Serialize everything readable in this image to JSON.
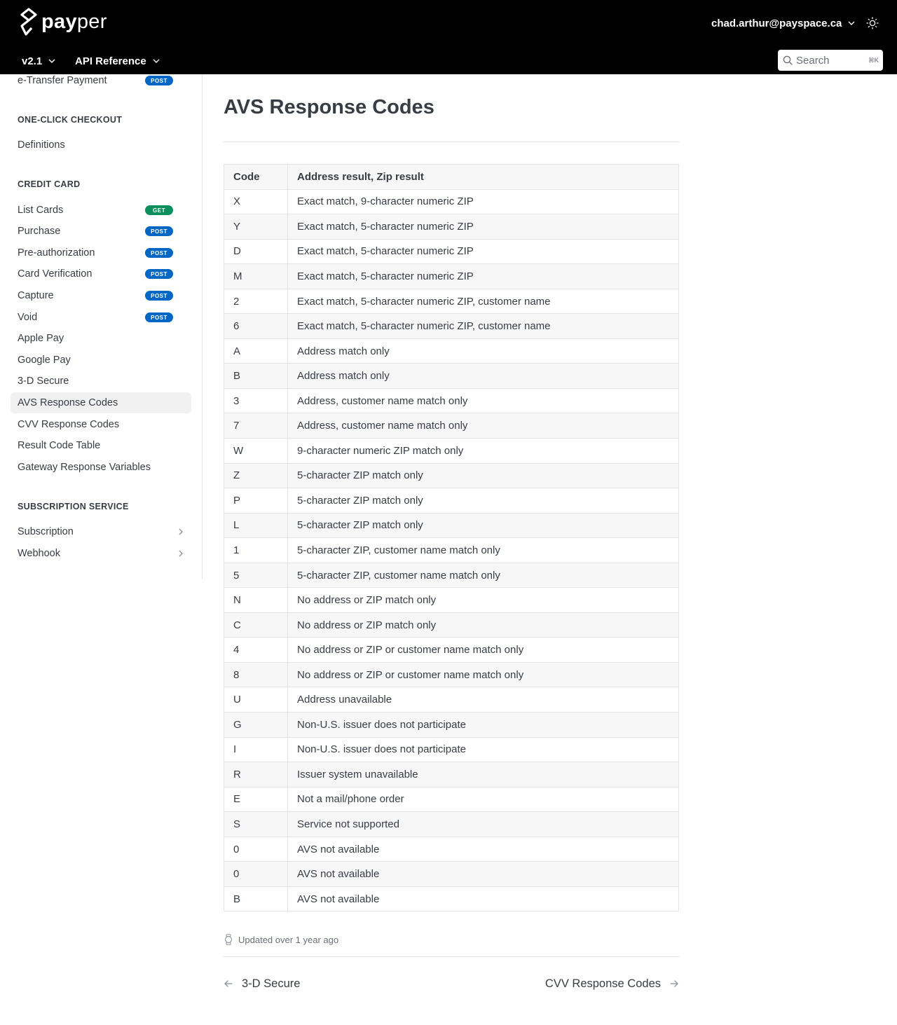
{
  "brand": {
    "name_bold": "pay",
    "name_regular": "per"
  },
  "header": {
    "user_email": "chad.arthur@payspace.ca",
    "version_label": "v2.1",
    "reference_label": "API Reference",
    "search_placeholder": "Search",
    "search_shortcut": "⌘K"
  },
  "sidebar": {
    "top_item": {
      "label": "e-Transfer Payment",
      "badge": "POST"
    },
    "sections": [
      {
        "title": "ONE-CLICK CHECKOUT",
        "items": [
          {
            "label": "Definitions"
          }
        ]
      },
      {
        "title": "CREDIT CARD",
        "items": [
          {
            "label": "List Cards",
            "badge": "GET"
          },
          {
            "label": "Purchase",
            "badge": "POST"
          },
          {
            "label": "Pre-authorization",
            "badge": "POST"
          },
          {
            "label": "Card Verification",
            "badge": "POST"
          },
          {
            "label": "Capture",
            "badge": "POST"
          },
          {
            "label": "Void",
            "badge": "POST"
          },
          {
            "label": "Apple Pay"
          },
          {
            "label": "Google Pay"
          },
          {
            "label": "3-D Secure"
          },
          {
            "label": "AVS Response Codes",
            "active": true
          },
          {
            "label": "CVV Response Codes"
          },
          {
            "label": "Result Code Table"
          },
          {
            "label": "Gateway Response Variables"
          }
        ]
      },
      {
        "title": "SUBSCRIPTION SERVICE",
        "items": [
          {
            "label": "Subscription"
          },
          {
            "label": "Webhook"
          }
        ]
      }
    ]
  },
  "page": {
    "title": "AVS Response Codes",
    "table": {
      "headers": [
        "Code",
        "Address result, Zip result"
      ],
      "rows": [
        [
          "X",
          "Exact match, 9-character numeric ZIP"
        ],
        [
          "Y",
          "Exact match, 5-character numeric ZIP"
        ],
        [
          "D",
          "Exact match, 5-character numeric ZIP"
        ],
        [
          "M",
          "Exact match, 5-character numeric ZIP"
        ],
        [
          "2",
          "Exact match, 5-character numeric ZIP, customer name"
        ],
        [
          "6",
          "Exact match, 5-character numeric ZIP, customer name"
        ],
        [
          "A",
          "Address match only"
        ],
        [
          "B",
          "Address match only"
        ],
        [
          "3",
          "Address, customer name match only"
        ],
        [
          "7",
          "Address, customer name match only"
        ],
        [
          "W",
          "9-character numeric ZIP match only"
        ],
        [
          "Z",
          "5-character ZIP match only"
        ],
        [
          "P",
          "5-character ZIP match only"
        ],
        [
          "L",
          "5-character ZIP match only"
        ],
        [
          "1",
          "5-character ZIP, customer name match only"
        ],
        [
          "5",
          "5-character ZIP, customer name match only"
        ],
        [
          "N",
          "No address or ZIP match only"
        ],
        [
          "C",
          "No address or ZIP match only"
        ],
        [
          "4",
          "No address or ZIP or customer name match only"
        ],
        [
          "8",
          "No address or ZIP or customer name match only"
        ],
        [
          "U",
          "Address unavailable"
        ],
        [
          "G",
          "Non-U.S. issuer does not participate"
        ],
        [
          "I",
          "Non-U.S. issuer does not participate"
        ],
        [
          "R",
          "Issuer system unavailable"
        ],
        [
          "E",
          "Not a mail/phone order"
        ],
        [
          "S",
          "Service not supported"
        ],
        [
          "0",
          "AVS not available"
        ],
        [
          "0",
          "AVS not available"
        ],
        [
          "B",
          "AVS not available"
        ]
      ]
    },
    "updated": "Updated over 1 year ago",
    "prev_label": "3-D Secure",
    "next_label": "CVV Response Codes"
  },
  "icons": {
    "logo": "payper-logo-icon",
    "chevron": "chevron-down-icon",
    "theme": "sun-icon",
    "search": "search-icon",
    "watch": "watch-icon",
    "prev": "arrow-left-icon",
    "next": "arrow-right-icon",
    "expand": "chevron-right-icon"
  },
  "colors": {
    "header_bg": "#000000",
    "post_badge": "#0166c4",
    "get_badge": "#0c8f5c",
    "active_item_bg": "#f1f1f1"
  }
}
